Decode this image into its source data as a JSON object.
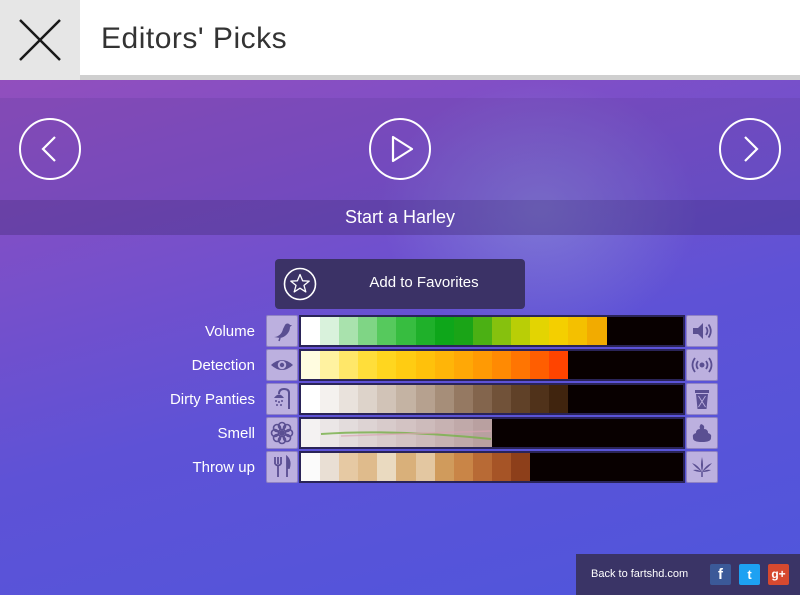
{
  "header": {
    "title": "Editors' Picks",
    "close_icon": "close-icon"
  },
  "player": {
    "track_title": "Start a Harley",
    "prev_icon": "chevron-left-icon",
    "play_icon": "play-icon",
    "next_icon": "chevron-right-icon",
    "favorite_label": "Add to Favorites",
    "favorite_icon": "star-icon"
  },
  "meters": [
    {
      "label": "Volume",
      "left_icon": "bird-icon",
      "right_icon": "speaker-icon",
      "level": 0.8,
      "colors": [
        "#ffffff",
        "#d9f2dc",
        "#a9e2ad",
        "#7fd585",
        "#56c95d",
        "#37bd40",
        "#1fb02a",
        "#0ea61a",
        "#1aa417",
        "#4bb014",
        "#86c10e",
        "#b9ce06",
        "#e3d402",
        "#f4cf00",
        "#f4c000",
        "#f2ab00"
      ]
    },
    {
      "label": "Detection",
      "left_icon": "eye-icon",
      "right_icon": "broadcast-icon",
      "level": 0.7,
      "colors": [
        "#fffce0",
        "#fff2a0",
        "#ffe769",
        "#ffde3a",
        "#ffd61f",
        "#ffcc12",
        "#ffc10b",
        "#ffb508",
        "#ffa806",
        "#ff9a04",
        "#ff8a03",
        "#ff7502",
        "#ff5e01",
        "#ff4400"
      ]
    },
    {
      "label": "Dirty Panties",
      "left_icon": "shower-icon",
      "right_icon": "trash-icon",
      "level": 0.7,
      "colors": [
        "#ffffff",
        "#f4f1ee",
        "#e9e2dc",
        "#ddd3ca",
        "#d1c3b7",
        "#c4b3a3",
        "#b6a18f",
        "#a68e79",
        "#957962",
        "#83654d",
        "#715239",
        "#604128",
        "#50321a",
        "#40240e"
      ]
    },
    {
      "label": "Smell",
      "left_icon": "flower-icon",
      "right_icon": "poop-icon",
      "level": 0.5,
      "colors": [
        "#f4f2f2",
        "#ebe6e6",
        "#e3dcdc",
        "#ddd3d3",
        "#d8cbcb",
        "#d3c3c3",
        "#cdbbbb",
        "#c7b2b2",
        "#c0a9a9",
        "#b9a0a0"
      ]
    },
    {
      "label": "Throw up",
      "left_icon": "fork-knife-icon",
      "right_icon": "weed-icon",
      "level": 0.6,
      "colors": [
        "#fbfbfb",
        "#e9dfd4",
        "#e6c9a3",
        "#dfbb8c",
        "#eadac0",
        "#d9b07a",
        "#e3c7a1",
        "#d09b5c",
        "#c98547",
        "#b86a35",
        "#a65426",
        "#8d3f1a"
      ]
    }
  ],
  "footer": {
    "back_label": "Back to fartshd.com",
    "facebook": "f",
    "twitter": "t",
    "google": "g+"
  }
}
